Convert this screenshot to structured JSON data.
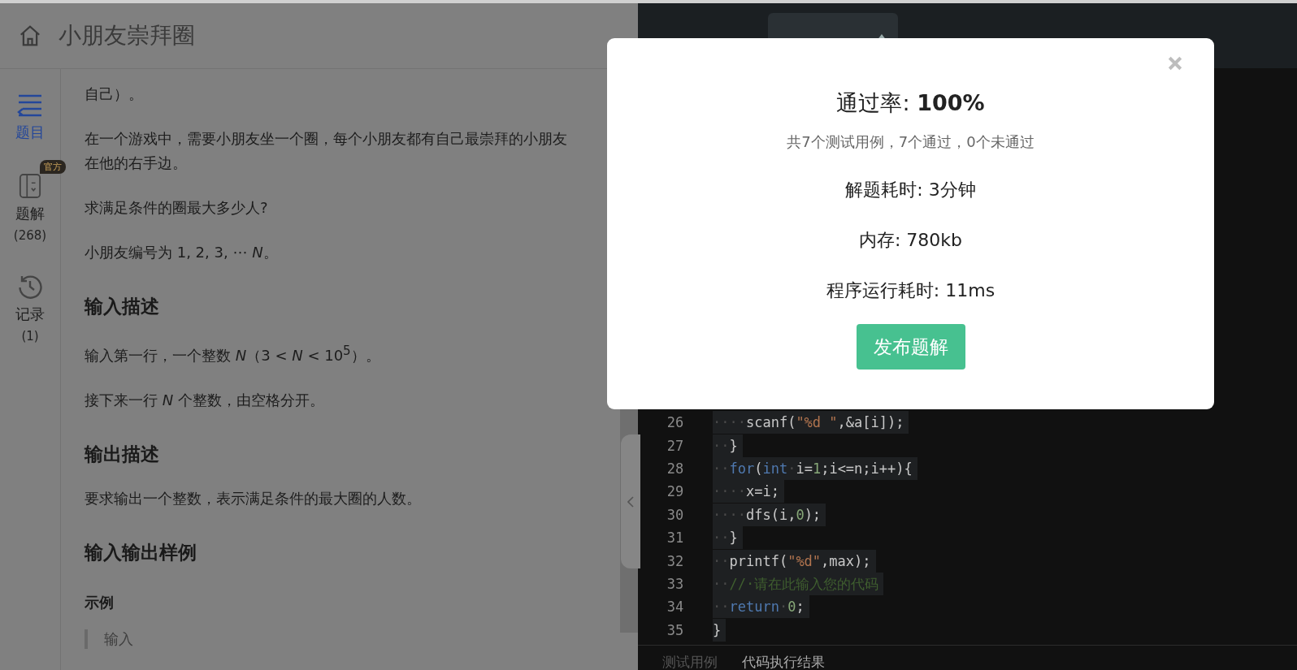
{
  "header": {
    "title": "小朋友崇拜圈"
  },
  "sidebar": {
    "items": [
      {
        "kind": "list",
        "label": "题目",
        "selected": true
      },
      {
        "kind": "book",
        "label": "题解",
        "badge": "官方",
        "count": "(268)",
        "selected": false
      },
      {
        "kind": "history",
        "label": "记录",
        "count": "(1)",
        "selected": false
      }
    ]
  },
  "problem": {
    "blocks": [
      {
        "kind": "p",
        "text": "自己）。"
      },
      {
        "kind": "p",
        "text": "在一个游戏中，需要小朋友坐一个圈，每个小朋友都有自己最崇拜的小朋友在他的右手边。"
      },
      {
        "kind": "p",
        "text": "求满足条件的圈最大多少人?"
      },
      {
        "kind": "p",
        "text": "小朋友编号为 1, 2, 3, ⋯ *N*。"
      },
      {
        "kind": "h2",
        "text": "输入描述"
      },
      {
        "kind": "p",
        "text": "输入第一行，一个整数 *N*（3 < *N* < 10$^{5}$）。"
      },
      {
        "kind": "p",
        "text": "接下来一行 *N* 个整数，由空格分开。"
      },
      {
        "kind": "h2",
        "text": "输出描述"
      },
      {
        "kind": "p",
        "text": "要求输出一个整数，表示满足条件的最大圈的人数。"
      },
      {
        "kind": "h2",
        "text": "输入输出样例"
      },
      {
        "kind": "h3",
        "text": "示例"
      },
      {
        "kind": "quote",
        "text": "输入"
      }
    ]
  },
  "editor": {
    "lines": [
      {
        "number": "26",
        "tokens": [
          {
            "kind": "ws",
            "text": "····"
          },
          {
            "kind": "plain",
            "text": "scanf("
          },
          {
            "kind": "str",
            "text": "\"%d \""
          },
          {
            "kind": "plain",
            "text": ",&a[i]);"
          }
        ]
      },
      {
        "number": "27",
        "tokens": [
          {
            "kind": "ws",
            "text": "··"
          },
          {
            "kind": "plain",
            "text": "}"
          }
        ]
      },
      {
        "number": "28",
        "tokens": [
          {
            "kind": "ws",
            "text": "··"
          },
          {
            "kind": "kw",
            "text": "for"
          },
          {
            "kind": "plain",
            "text": "("
          },
          {
            "kind": "kw",
            "text": "int"
          },
          {
            "kind": "ws",
            "text": "·"
          },
          {
            "kind": "plain",
            "text": "i="
          },
          {
            "kind": "num",
            "text": "1"
          },
          {
            "kind": "plain",
            "text": ";i<=n;i++){"
          }
        ]
      },
      {
        "number": "29",
        "tokens": [
          {
            "kind": "ws",
            "text": "····"
          },
          {
            "kind": "plain",
            "text": "x=i;"
          }
        ]
      },
      {
        "number": "30",
        "tokens": [
          {
            "kind": "ws",
            "text": "····"
          },
          {
            "kind": "plain",
            "text": "dfs(i,"
          },
          {
            "kind": "num",
            "text": "0"
          },
          {
            "kind": "plain",
            "text": ");"
          }
        ]
      },
      {
        "number": "31",
        "tokens": [
          {
            "kind": "ws",
            "text": "··"
          },
          {
            "kind": "plain",
            "text": "}"
          }
        ]
      },
      {
        "number": "32",
        "tokens": [
          {
            "kind": "ws",
            "text": "··"
          },
          {
            "kind": "plain",
            "text": "printf("
          },
          {
            "kind": "str",
            "text": "\"%d\""
          },
          {
            "kind": "plain",
            "text": ",max);"
          }
        ]
      },
      {
        "number": "33",
        "tokens": [
          {
            "kind": "ws",
            "text": "··"
          },
          {
            "kind": "comment",
            "text": "//·请在此输入您的代码"
          }
        ]
      },
      {
        "number": "34",
        "tokens": [
          {
            "kind": "ws",
            "text": "··"
          },
          {
            "kind": "kw",
            "text": "return"
          },
          {
            "kind": "ws",
            "text": "·"
          },
          {
            "kind": "num",
            "text": "0"
          },
          {
            "kind": "plain",
            "text": ";"
          }
        ]
      },
      {
        "number": "35",
        "tokens": [
          {
            "kind": "plain",
            "text": "}"
          }
        ]
      }
    ]
  },
  "bottom_tabs": [
    {
      "label": "测试用例",
      "selected": false
    },
    {
      "label": "代码执行结果",
      "selected": true
    }
  ],
  "modal": {
    "title": "通过率: **100%**",
    "summary": "共7个测试用例，7个通过，0个未通过",
    "stats": [
      "解题耗时: 3分钟",
      "内存: 780kb",
      "程序运行耗时: 11ms"
    ],
    "button": "发布题解"
  }
}
